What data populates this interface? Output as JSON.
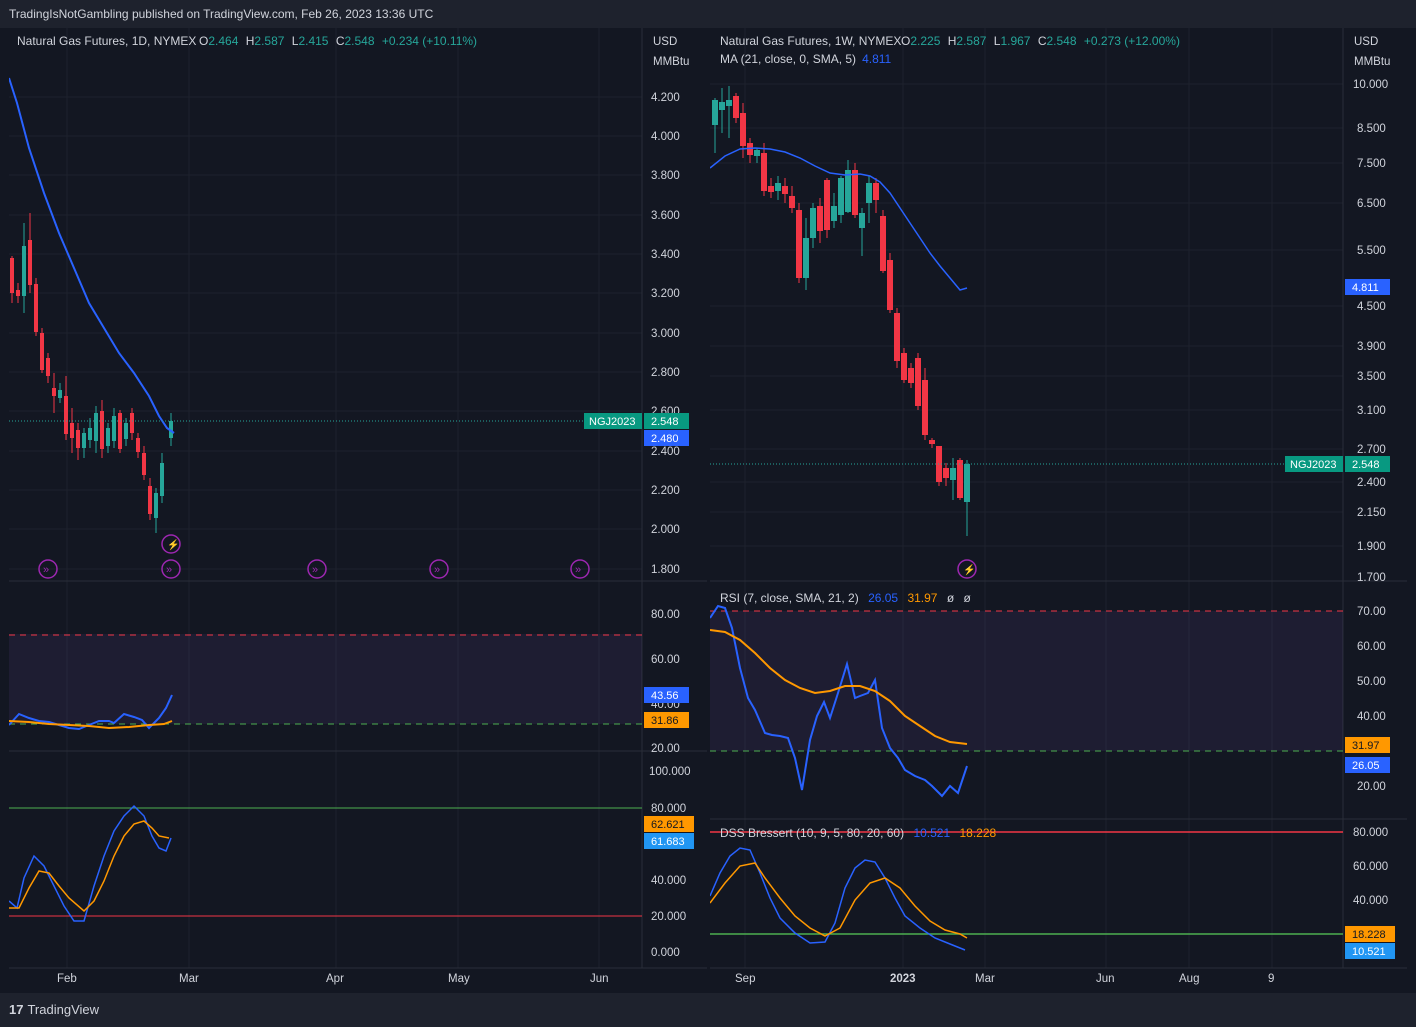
{
  "header": {
    "published": "TradingIsNotGambling published on TradingView.com, Feb 26, 2023 13:36 UTC"
  },
  "footer": {
    "brand": "TradingView",
    "brand_mark": "17"
  },
  "colors": {
    "bg": "#131722",
    "up": "#26a69a",
    "down": "#f23645",
    "ma": "#2962ff",
    "rsi_line": "#2962ff",
    "rsi_ma": "#ff9800",
    "grid": "#1e222d"
  },
  "left": {
    "legend": {
      "symbol": "Natural Gas Futures, 1D, NYMEX",
      "o_label": "O",
      "o": "2.464",
      "h_label": "H",
      "h": "2.587",
      "l_label": "L",
      "l": "2.415",
      "c_label": "C",
      "c": "2.548",
      "chg": "+0.234 (+10.11%)"
    },
    "currency": "USD",
    "unit": "MMBtu",
    "price_ticks": [
      "4.200",
      "4.000",
      "3.800",
      "3.600",
      "3.400",
      "3.200",
      "3.000",
      "2.800",
      "2.600",
      "2.400",
      "2.200",
      "2.000",
      "1.800"
    ],
    "price_tag_symbol": "NGJ2023",
    "price_tag": "2.548",
    "ma_tag": "2.480",
    "rsi_ticks": [
      "80.00",
      "60.00",
      "40.00",
      "20.00"
    ],
    "rsi_tag": "43.56",
    "rsi_ma_tag": "31.86",
    "dss_ticks": [
      "100.000",
      "80.000",
      "60.000",
      "40.000",
      "20.000",
      "0.000"
    ],
    "dss_tag1": "62.621",
    "dss_tag2": "61.683",
    "time_labels": [
      "Feb",
      "Mar",
      "Apr",
      "May",
      "Jun"
    ]
  },
  "right": {
    "legend": {
      "symbol": "Natural Gas Futures, 1W, NYMEX",
      "o_label": "O",
      "o": "2.225",
      "h_label": "H",
      "h": "2.587",
      "l_label": "L",
      "l": "1.967",
      "c_label": "C",
      "c": "2.548",
      "chg": "+0.273 (+12.00%)"
    },
    "ma_legend": "MA (21, close, 0, SMA, 5)",
    "ma_value": "4.811",
    "currency": "USD",
    "unit": "MMBtu",
    "price_ticks": [
      "10.000",
      "8.500",
      "7.500",
      "6.500",
      "5.500",
      "4.500",
      "3.900",
      "3.500",
      "3.100",
      "2.700",
      "2.400",
      "2.150",
      "1.900",
      "1.700"
    ],
    "price_tag_symbol": "NGJ2023",
    "price_tag": "2.548",
    "ma_tag": "4.811",
    "rsi_legend": "RSI (7, close, SMA, 21, 2)",
    "rsi_v1": "26.05",
    "rsi_v2": "31.97",
    "rsi_v3": "ø",
    "rsi_v4": "ø",
    "rsi_ticks": [
      "70.00",
      "60.00",
      "50.00",
      "40.00",
      "20.00"
    ],
    "rsi_tag1": "31.97",
    "rsi_tag2": "26.05",
    "dss_legend": "DSS Bressert (10, 9, 5, 80, 20, 60)",
    "dss_v1": "10.521",
    "dss_v2": "18.228",
    "dss_ticks": [
      "80.000",
      "60.000",
      "40.000"
    ],
    "dss_tag1": "18.228",
    "dss_tag2": "10.521",
    "time_labels": [
      "Sep",
      "2023",
      "Mar",
      "Jun",
      "Aug",
      "9"
    ]
  }
}
